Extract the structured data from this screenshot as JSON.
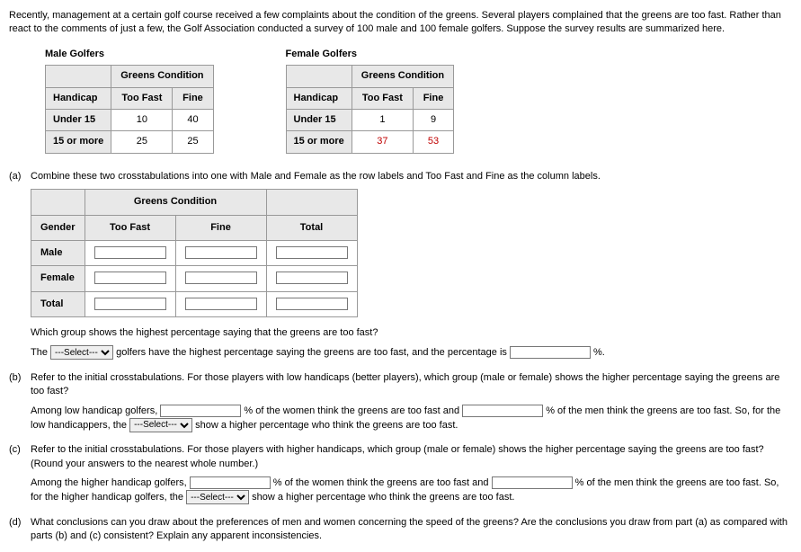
{
  "intro": "Recently, management at a certain golf course received a few complaints about the condition of the greens. Several players complained that the greens are too fast. Rather than react to the comments of just a few, the Golf Association conducted a survey of 100 male and 100 female golfers. Suppose the survey results are summarized here.",
  "male": {
    "caption": "Male Golfers",
    "colhead_span": "Greens Condition",
    "rowhead": "Handicap",
    "cols": [
      "Too Fast",
      "Fine"
    ],
    "rows": [
      {
        "label": "Under 15",
        "vals": [
          "10",
          "40"
        ]
      },
      {
        "label": "15 or more",
        "vals": [
          "25",
          "25"
        ]
      }
    ]
  },
  "female": {
    "caption": "Female Golfers",
    "colhead_span": "Greens Condition",
    "rowhead": "Handicap",
    "cols": [
      "Too Fast",
      "Fine"
    ],
    "rows": [
      {
        "label": "Under 15",
        "vals": [
          "1",
          "9"
        ]
      },
      {
        "label": "15 or more",
        "vals": [
          "37",
          "53"
        ],
        "red": true
      }
    ]
  },
  "parts": {
    "a": {
      "label": "(a)",
      "prompt": "Combine these two crosstabulations into one with Male and Female as the row labels and Too Fast and Fine as the column labels.",
      "table": {
        "colhead_span": "Greens Condition",
        "rowhead": "Gender",
        "cols": [
          "Too Fast",
          "Fine"
        ],
        "total": "Total",
        "rows": [
          "Male",
          "Female",
          "Total"
        ]
      },
      "q1": "Which group shows the highest percentage saying that the greens are too fast?",
      "line2_pre": "The",
      "select_placeholder": "---Select---",
      "line2_mid": "golfers have the highest percentage saying the greens are too fast, and the percentage is",
      "pct": "%."
    },
    "b": {
      "label": "(b)",
      "prompt": "Refer to the initial crosstabulations. For those players with low handicaps (better players), which group (male or female) shows the higher percentage saying the greens are too fast?",
      "line_pre": "Among low handicap golfers,",
      "mid1": "% of the women think the greens are too fast and",
      "mid2": "% of the men think the greens are too fast. So, for the low handicappers, the",
      "select_placeholder": "---Select---",
      "tail": "show a higher percentage who think the greens are too fast."
    },
    "c": {
      "label": "(c)",
      "prompt": "Refer to the initial crosstabulations. For those players with higher handicaps, which group (male or female) shows the higher percentage saying the greens are too fast? (Round your answers to the nearest whole number.)",
      "line_pre": "Among the higher handicap golfers,",
      "mid1": "% of the women think the greens are too fast and",
      "mid2": "% of the men think the greens are too fast. So, for the higher handicap golfers, the",
      "select_placeholder": "---Select---",
      "tail": "show a higher percentage who think the greens are too fast."
    },
    "d": {
      "label": "(d)",
      "prompt": "What conclusions can you draw about the preferences of men and women concerning the speed of the greens? Are the conclusions you draw from part (a) as compared with parts (b) and (c) consistent? Explain any apparent inconsistencies."
    }
  }
}
